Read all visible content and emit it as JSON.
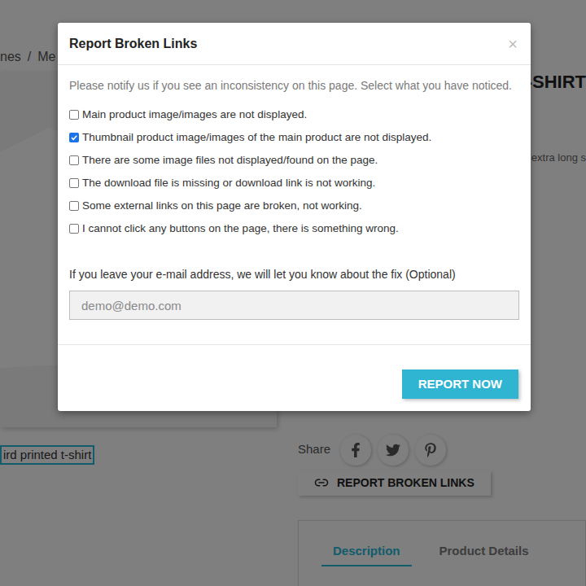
{
  "page": {
    "breadcrumb": [
      "nes",
      "/",
      "Me"
    ],
    "title": "-SHIRT",
    "summary": "f extra long s",
    "image_caption": "ird printed t-shirt",
    "share_label": "Share",
    "report_button": "REPORT BROKEN LINKS",
    "tabs": [
      {
        "label": "Description",
        "selected": true
      },
      {
        "label": "Product Details",
        "selected": false
      }
    ]
  },
  "dialog": {
    "title": "Report Broken Links",
    "close": "×",
    "intro": "Please notify us if you see an inconsistency on this page. Select what you have noticed.",
    "options": [
      {
        "label": "Main product image/images are not displayed.",
        "checked": false
      },
      {
        "label": "Thumbnail product image/images of the main product are not displayed.",
        "checked": true
      },
      {
        "label": "There are some image files not displayed/found on the page.",
        "checked": false
      },
      {
        "label": "The download file is missing or download link is not working.",
        "checked": false
      },
      {
        "label": "Some external links on this page are broken, not working.",
        "checked": false
      },
      {
        "label": "I cannot click any buttons on the page, there is something wrong.",
        "checked": false
      }
    ],
    "email_label": "If you leave your e-mail address, we will let you know about the fix (Optional)",
    "email_placeholder": "demo@demo.com",
    "submit": "REPORT NOW"
  }
}
